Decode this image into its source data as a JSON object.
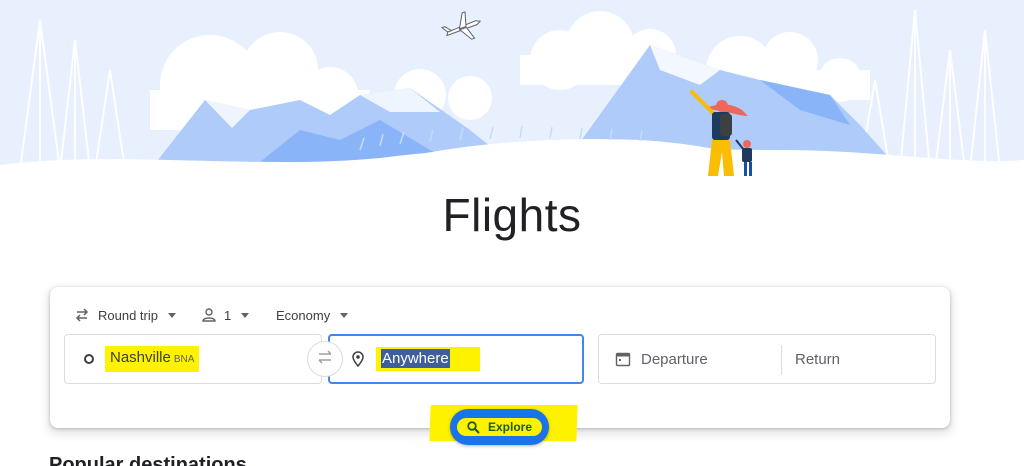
{
  "page": {
    "title": "Flights"
  },
  "trip_options": {
    "trip_type": "Round trip",
    "passengers": "1",
    "cabin_class": "Economy"
  },
  "search": {
    "origin_city": "Nashville",
    "origin_code": "BNA",
    "destination_value": "Anywhere",
    "departure_placeholder": "Departure",
    "return_placeholder": "Return"
  },
  "actions": {
    "explore_label": "Explore"
  },
  "icons": {
    "trip_type": "swap-horizontal-icon",
    "passengers": "person-icon",
    "origin": "circle-icon",
    "swap": "swap-icon",
    "destination": "location-pin-icon",
    "calendar": "calendar-icon",
    "explore": "search-icon"
  },
  "colors": {
    "accent": "#1a73e8",
    "highlight": "#fff200",
    "hero_sky": "#e8f0fe",
    "focus_border": "#4285f4"
  },
  "section": {
    "heading": "Popular destinations"
  }
}
